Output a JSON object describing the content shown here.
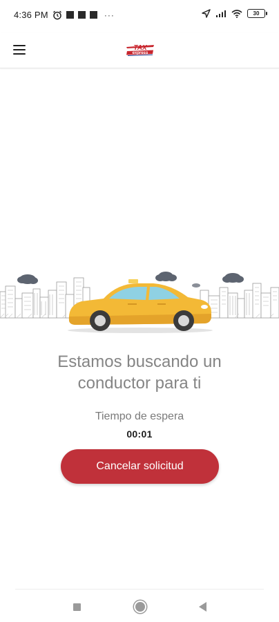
{
  "status_bar": {
    "time": "4:36 PM",
    "overflow": "···",
    "battery": "30",
    "icons": [
      "alarm-icon",
      "notification-square",
      "notification-square",
      "notification-square",
      "location-icon",
      "signal-icon",
      "wifi-icon",
      "battery-icon"
    ]
  },
  "app_bar": {
    "logo_text_top": "TAX",
    "logo_text_bottom": "express",
    "brand_color": "#c8262e",
    "logo_secondary_color": "#1f3c8f"
  },
  "main": {
    "headline_line1": "Estamos buscando un",
    "headline_line2": "conductor para ti",
    "wait_label": "Tiempo de espera",
    "wait_time": "00:01",
    "cancel_label": "Cancelar solicitud",
    "cancel_color": "#c0313a",
    "illustration": "taxi-car-city-illustration"
  },
  "nav_bar": {
    "buttons": [
      "recents-square-icon",
      "home-circle-icon",
      "back-triangle-icon"
    ]
  }
}
